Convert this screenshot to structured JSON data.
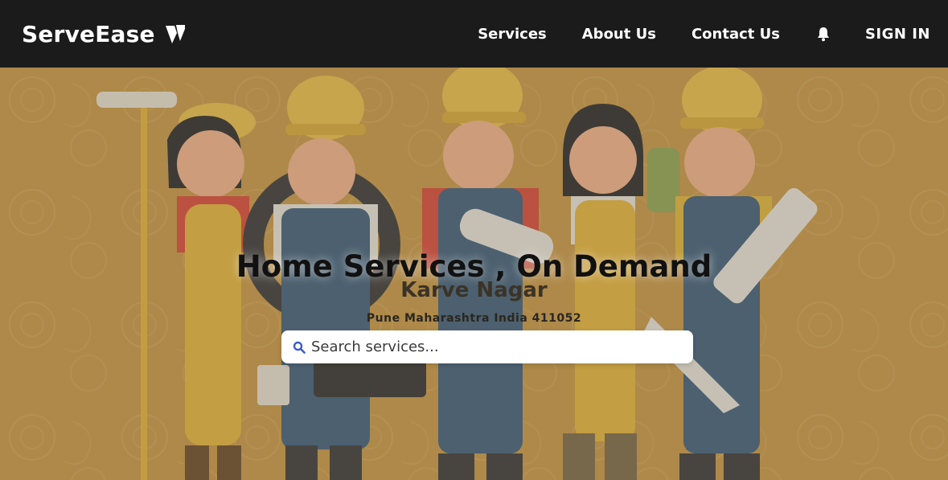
{
  "navbar": {
    "brand": "ServeEase",
    "links": [
      "Services",
      "About Us",
      "Contact Us"
    ],
    "signin": "SIGN IN"
  },
  "hero": {
    "title": "Home Services , On Demand",
    "locality": "Karve Nagar",
    "address": "Pune Maharashtra India 411052",
    "search_placeholder": "Search services..."
  },
  "colors": {
    "navbar_bg": "#1c1b1b",
    "hero_bg": "#c69746",
    "helmet": "#e8b63c",
    "overalls": "#3f5f7a"
  },
  "icons": [
    "brand-logo-icon",
    "bell-icon",
    "search-icon"
  ]
}
